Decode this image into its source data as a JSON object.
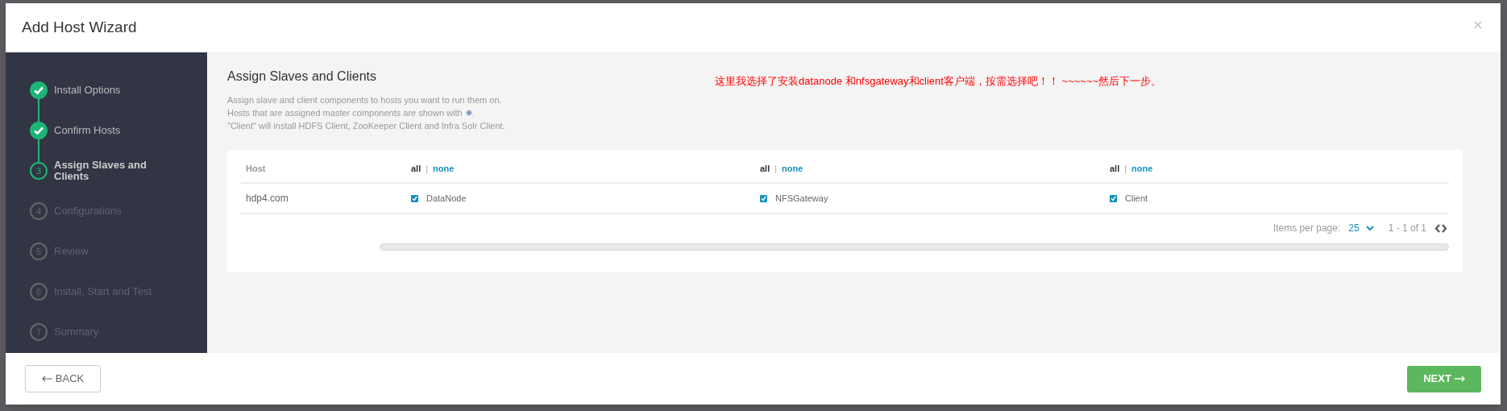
{
  "window": {
    "title": "Add Host Wizard"
  },
  "steps": [
    {
      "label": "Install Options",
      "completed": true,
      "selected": false
    },
    {
      "label": "Confirm Hosts",
      "completed": true,
      "selected": false
    },
    {
      "number": "3",
      "label": "Assign Slaves and Clients",
      "completed": false,
      "selected": true
    },
    {
      "number": "4",
      "label": "Configurations",
      "completed": false,
      "selected": false
    },
    {
      "number": "5",
      "label": "Review",
      "completed": false,
      "selected": false
    },
    {
      "number": "6",
      "label": "Install, Start and Test",
      "completed": false,
      "selected": false
    },
    {
      "number": "7",
      "label": "Summary",
      "completed": false,
      "selected": false
    }
  ],
  "page": {
    "heading": "Assign Slaves and Clients",
    "description": [
      "Assign slave and client components to hosts you want to run them on.",
      "Hosts that are assigned master components are shown with",
      "\"Client\" will install HDFS Client, ZooKeeper Client and Infra Solr Client."
    ],
    "description_end": ".",
    "annotation": "这里我选择了安装datanode 和nfsgateway和client客户端，按需选择吧！！ ~~~~~~然后下一步。"
  },
  "table": {
    "host_column": "Host",
    "columns": [
      {
        "all": "all",
        "separator": "|",
        "none": "none"
      },
      {
        "all": "all",
        "separator": "|",
        "none": "none"
      },
      {
        "all": "all",
        "separator": "|",
        "none": "none"
      }
    ],
    "rows": [
      {
        "host": "hdp4.com",
        "components": [
          {
            "label": "DataNode",
            "checked": true
          },
          {
            "label": "NFSGateway",
            "checked": true
          },
          {
            "label": "Client",
            "checked": true
          }
        ]
      }
    ]
  },
  "pagination": {
    "items_per_page_label": "Items per page:",
    "items_per_page": "25",
    "range": "1 - 1 of 1"
  },
  "buttons": {
    "back": "BACK",
    "next": "NEXT"
  }
}
